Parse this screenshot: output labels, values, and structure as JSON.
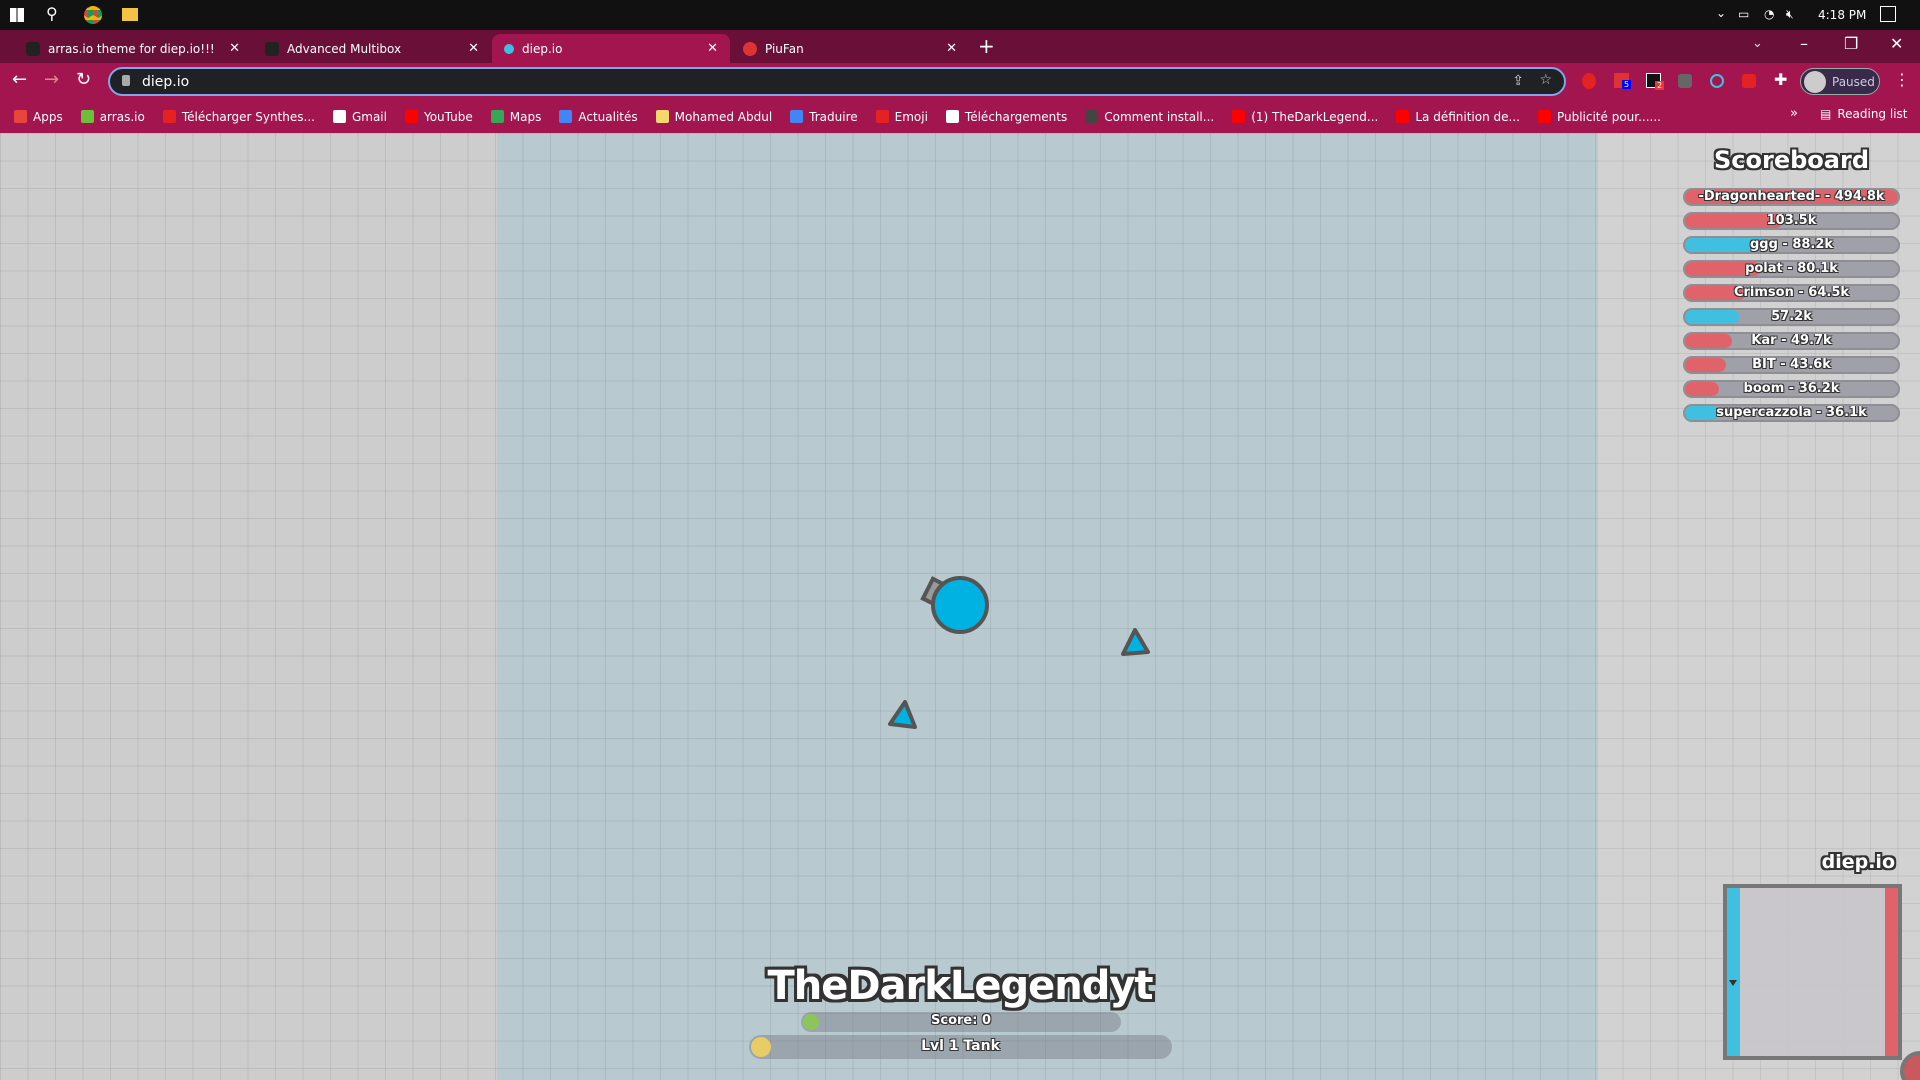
{
  "taskbar": {
    "time": "4:18 PM"
  },
  "tabs": [
    {
      "label": "arras.io theme for diep.io!!!",
      "active": false
    },
    {
      "label": "Advanced Multibox",
      "active": false
    },
    {
      "label": "diep.io",
      "active": true
    },
    {
      "label": "PiuFan",
      "active": false
    }
  ],
  "toolbar": {
    "url": "diep.io",
    "profile_label": "Paused",
    "extension_badges": [
      "5",
      "2"
    ]
  },
  "bookmarks": [
    {
      "label": "Apps",
      "color": "#e8453c"
    },
    {
      "label": "arras.io",
      "color": "#6cbf3a"
    },
    {
      "label": "Télécharger Synthes...",
      "color": "#e52222"
    },
    {
      "label": "Gmail",
      "color": "#ffffff"
    },
    {
      "label": "YouTube",
      "color": "#ff0000"
    },
    {
      "label": "Maps",
      "color": "#34a853"
    },
    {
      "label": "Actualités",
      "color": "#4285f4"
    },
    {
      "label": "Mohamed Abdul",
      "color": "#f5d76e"
    },
    {
      "label": "Traduire",
      "color": "#4285f4"
    },
    {
      "label": "Emoji",
      "color": "#e52222"
    },
    {
      "label": "Téléchargements",
      "color": "#ffffff"
    },
    {
      "label": "Comment install...",
      "color": "#444444"
    },
    {
      "label": "(1) TheDarkLegend...",
      "color": "#ff0000"
    },
    {
      "label": "La définition de...",
      "color": "#ff0000"
    },
    {
      "label": "Publicité pour......",
      "color": "#ff0000"
    }
  ],
  "reading_list": "Reading list",
  "scoreboard": {
    "title": "Scoreboard",
    "entries": [
      {
        "label": "-Dragonhearted- - 494.8k",
        "score": 494.8,
        "team": "red"
      },
      {
        "label": "103.5k",
        "score": 103.5,
        "team": "red"
      },
      {
        "label": "ggg - 88.2k",
        "score": 88.2,
        "team": "blue"
      },
      {
        "label": "polat - 80.1k",
        "score": 80.1,
        "team": "red"
      },
      {
        "label": "Crimson - 64.5k",
        "score": 64.5,
        "team": "red"
      },
      {
        "label": "57.2k",
        "score": 57.2,
        "team": "blue"
      },
      {
        "label": "Kar - 49.7k",
        "score": 49.7,
        "team": "red"
      },
      {
        "label": "BIT - 43.6k",
        "score": 43.6,
        "team": "red"
      },
      {
        "label": "boom - 36.2k",
        "score": 36.2,
        "team": "red"
      },
      {
        "label": "supercazzola - 36.1k",
        "score": 36.1,
        "team": "blue"
      }
    ]
  },
  "colors": {
    "red": "#e0636b",
    "blue": "#3fc0e0",
    "tank": "#00b2e1",
    "outline": "#555555"
  },
  "player": {
    "name": "TheDarkLegendyt",
    "score_label": "Score: 0",
    "level_label": "Lvl 1 Tank"
  },
  "minimap": {
    "label": "diep.io"
  }
}
